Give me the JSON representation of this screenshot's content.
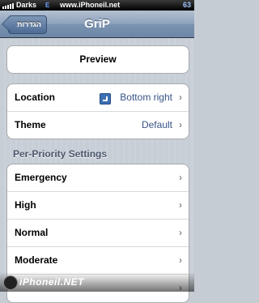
{
  "statusbar": {
    "carrier": "Darks",
    "network": "E",
    "site": "www.iPhoneil.net",
    "battery": "63"
  },
  "navbar": {
    "back_label": "הגדרות",
    "title": "GriP"
  },
  "preview": {
    "label": "Preview"
  },
  "settings": {
    "location_label": "Location",
    "location_value": "Bottom right",
    "theme_label": "Theme",
    "theme_value": "Default"
  },
  "per_priority": {
    "header": "Per-Priority Settings",
    "items": [
      {
        "label": "Emergency"
      },
      {
        "label": "High"
      },
      {
        "label": "Normal"
      },
      {
        "label": "Moderate"
      }
    ]
  },
  "watermark": {
    "text": "iPhoneil.NET"
  }
}
